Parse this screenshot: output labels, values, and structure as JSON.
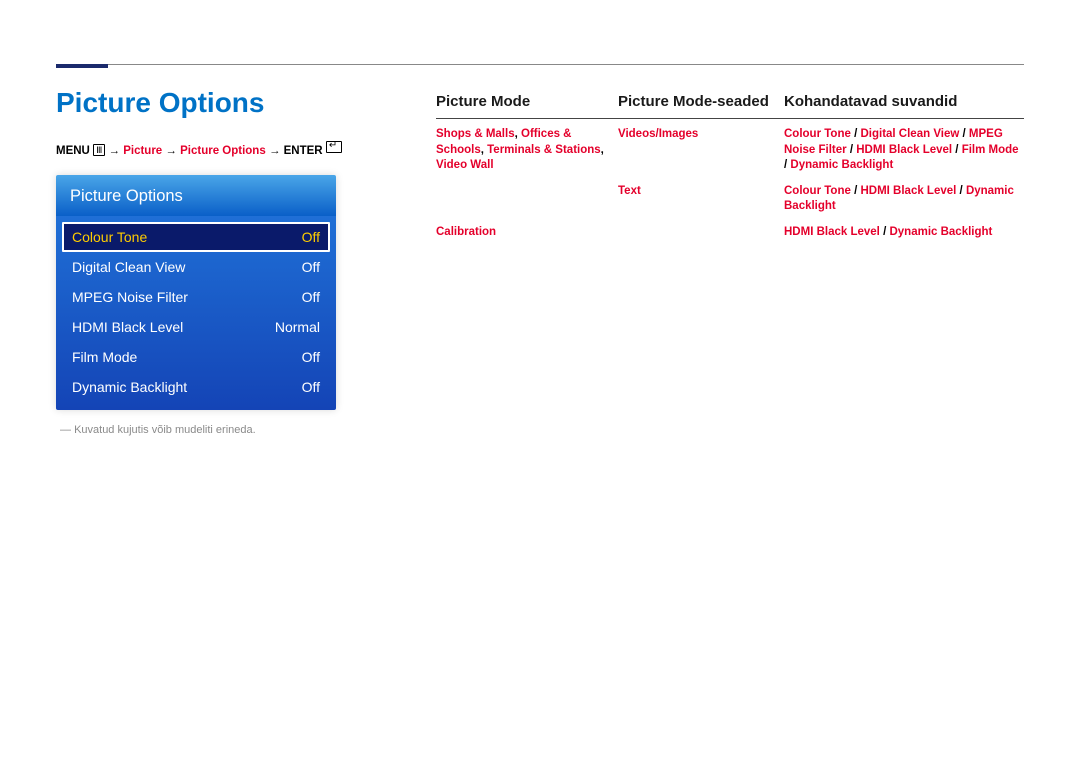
{
  "section_title": "Picture Options",
  "breadcrumb": {
    "menu": "MENU",
    "arrow": " → ",
    "picture": "Picture",
    "picture_options": "Picture Options",
    "enter": "ENTER"
  },
  "osd": {
    "title": "Picture Options",
    "rows": [
      {
        "label": "Colour Tone",
        "value": "Off",
        "selected": true
      },
      {
        "label": "Digital Clean View",
        "value": "Off",
        "selected": false
      },
      {
        "label": "MPEG Noise Filter",
        "value": "Off",
        "selected": false
      },
      {
        "label": "HDMI Black Level",
        "value": "Normal",
        "selected": false
      },
      {
        "label": "Film Mode",
        "value": "Off",
        "selected": false
      },
      {
        "label": "Dynamic Backlight",
        "value": "Off",
        "selected": false
      }
    ]
  },
  "footnote_prefix": "―  ",
  "footnote": "Kuvatud kujutis võib mudeliti erineda.",
  "table": {
    "headers": {
      "c1": "Picture Mode",
      "c2": "Picture Mode-seaded",
      "c3": "Kohandatavad suvandid"
    },
    "rows": [
      {
        "c1_parts": [
          "Shops & Malls",
          ", ",
          "Offices & Schools",
          ", ",
          "Terminals & Stations",
          ", ",
          "Video Wall"
        ],
        "c2": "Videos/Images",
        "c3_parts": [
          "Colour Tone",
          " / ",
          "Digital Clean View",
          " / ",
          "MPEG Noise Filter",
          " / ",
          "HDMI Black Level",
          " / ",
          "Film Mode",
          " / ",
          "Dynamic Backlight"
        ]
      },
      {
        "c1_parts": [
          ""
        ],
        "c2": "Text",
        "c3_parts": [
          "Colour Tone",
          " / ",
          "HDMI Black Level",
          " / ",
          "Dynamic Backlight"
        ]
      },
      {
        "c1_parts": [
          "Calibration"
        ],
        "c2": "",
        "c3_parts": [
          "HDMI Black Level",
          " / ",
          "Dynamic Backlight"
        ]
      }
    ]
  }
}
